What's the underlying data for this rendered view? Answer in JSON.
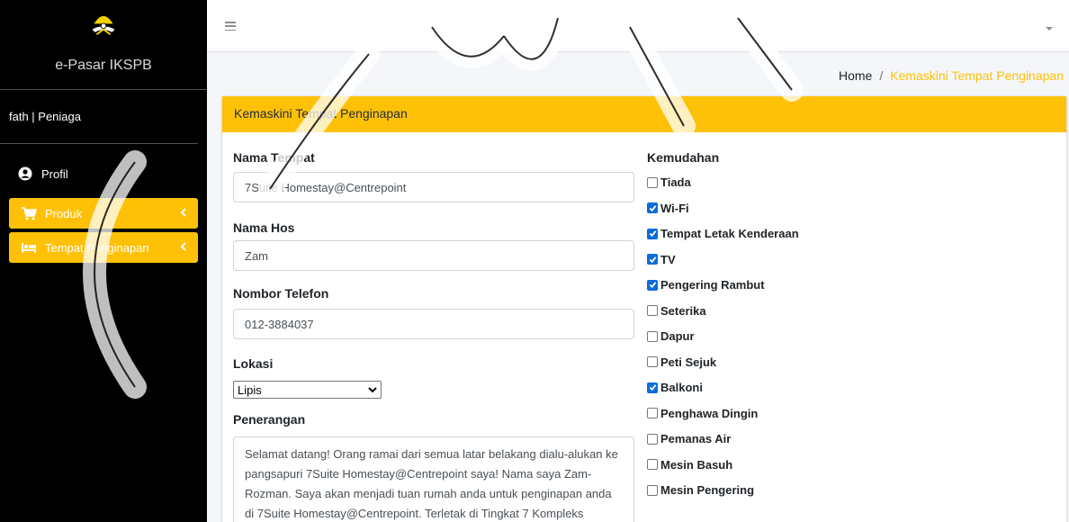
{
  "sidebar": {
    "brand": "e-Pasar IKSPB",
    "user": "fath | Peniaga",
    "items": [
      {
        "label": "Profil",
        "icon": "user-circle-icon"
      },
      {
        "label": "Produk",
        "icon": "cart-icon"
      },
      {
        "label": "Tempat Penginapan",
        "icon": "bed-icon"
      }
    ]
  },
  "breadcrumb": {
    "home": "Home",
    "sep": "/",
    "current": "Kemaskini Tempat Penginapan"
  },
  "card": {
    "title": "Kemaskini Tempat Penginapan"
  },
  "form": {
    "nama_tempat": {
      "label": "Nama Tempat",
      "value": "7Suite Homestay@Centrepoint"
    },
    "nama_hos": {
      "label": "Nama Hos",
      "value": "Zam"
    },
    "telefon": {
      "label": "Nombor Telefon",
      "value": "012-3884037"
    },
    "lokasi": {
      "label": "Lokasi",
      "value": "Lipis"
    },
    "penerangan": {
      "label": "Penerangan",
      "value": "Selamat datang! Orang ramai dari semua latar belakang dialu-alukan ke pangsapuri 7Suite Homestay@Centrepoint saya! Nama saya Zam-Rozman. Saya akan menjadi tuan rumah anda untuk penginapan anda di 7Suite Homestay@Centrepoint. Terletak di Tingkat 7 Kompleks"
    }
  },
  "kemudahan": {
    "label": "Kemudahan",
    "items": [
      {
        "label": "Tiada",
        "checked": false
      },
      {
        "label": "Wi-Fi",
        "checked": true
      },
      {
        "label": "Tempat Letak Kenderaan",
        "checked": true
      },
      {
        "label": "TV",
        "checked": true
      },
      {
        "label": "Pengering Rambut",
        "checked": true
      },
      {
        "label": "Seterika",
        "checked": false
      },
      {
        "label": "Dapur",
        "checked": false
      },
      {
        "label": "Peti Sejuk",
        "checked": false
      },
      {
        "label": "Balkoni",
        "checked": true
      },
      {
        "label": "Penghawa Dingin",
        "checked": false
      },
      {
        "label": "Pemanas Air",
        "checked": false
      },
      {
        "label": "Mesin Basuh",
        "checked": false
      },
      {
        "label": "Mesin Pengering",
        "checked": false
      }
    ]
  },
  "colors": {
    "accent": "#ffc107",
    "sidebar": "#000000",
    "checkbox": "#0b6cdb"
  }
}
